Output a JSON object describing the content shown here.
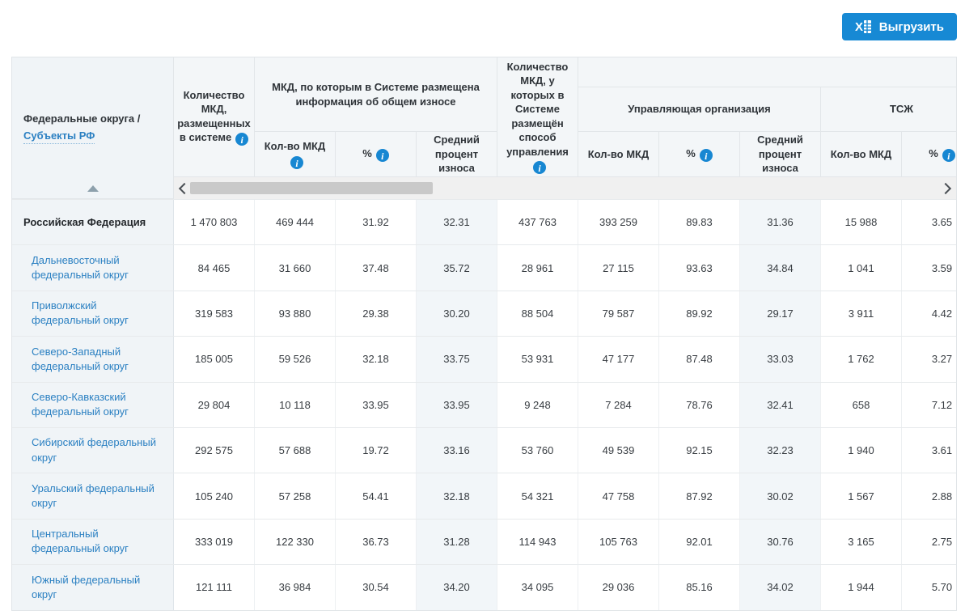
{
  "export_button": {
    "label": "Выгрузить"
  },
  "colors": {
    "accent_blue": "#1789d4",
    "link_blue": "#2b80c2",
    "info_icon_blue": "#1787d2",
    "header_bg": "#f3f6f8",
    "first_col_bg": "#f0f4f7",
    "shaded_col_bg": "#f2f6f9"
  },
  "table": {
    "header": {
      "col1": {
        "title": "Федеральные округа /",
        "link": "Субъекты РФ"
      },
      "col_total": {
        "label": "Количество МКД, размещенных в системе"
      },
      "group_wear": {
        "label": "МКД, по которым в Системе размещена информация об общем износе",
        "subs": [
          {
            "label": "Кол-во МКД"
          },
          {
            "label": "%"
          },
          {
            "label": "Средний процент износа"
          }
        ]
      },
      "col_mgmt": {
        "label": "Количество МКД, у которых в Системе размещён способ управления"
      },
      "group_uo": {
        "label": "Управляющая организация",
        "subs": [
          {
            "label": "Кол-во МКД"
          },
          {
            "label": "%"
          },
          {
            "label": "Средний процент износа"
          }
        ]
      },
      "group_tsj": {
        "label": "ТСЖ",
        "subs": [
          {
            "label": "Кол-во МКД"
          },
          {
            "label": "%"
          }
        ]
      }
    },
    "rows": [
      {
        "name": "Российская Федерация",
        "link": false,
        "values": [
          "1 470 803",
          "469 444",
          "31.92",
          "32.31",
          "437 763",
          "393 259",
          "89.83",
          "31.36",
          "15 988",
          "3.65"
        ]
      },
      {
        "name": "Дальневосточный федеральный округ",
        "link": true,
        "values": [
          "84 465",
          "31 660",
          "37.48",
          "35.72",
          "28 961",
          "27 115",
          "93.63",
          "34.84",
          "1 041",
          "3.59"
        ]
      },
      {
        "name": "Приволжский федеральный округ",
        "link": true,
        "values": [
          "319 583",
          "93 880",
          "29.38",
          "30.20",
          "88 504",
          "79 587",
          "89.92",
          "29.17",
          "3 911",
          "4.42"
        ]
      },
      {
        "name": "Северо-Западный федеральный округ",
        "link": true,
        "values": [
          "185 005",
          "59 526",
          "32.18",
          "33.75",
          "53 931",
          "47 177",
          "87.48",
          "33.03",
          "1 762",
          "3.27"
        ]
      },
      {
        "name": "Северо-Кавказский федеральный округ",
        "link": true,
        "values": [
          "29 804",
          "10 118",
          "33.95",
          "33.95",
          "9 248",
          "7 284",
          "78.76",
          "32.41",
          "658",
          "7.12"
        ]
      },
      {
        "name": "Сибирский федеральный округ",
        "link": true,
        "values": [
          "292 575",
          "57 688",
          "19.72",
          "33.16",
          "53 760",
          "49 539",
          "92.15",
          "32.23",
          "1 940",
          "3.61"
        ]
      },
      {
        "name": "Уральский федеральный округ",
        "link": true,
        "values": [
          "105 240",
          "57 258",
          "54.41",
          "32.18",
          "54 321",
          "47 758",
          "87.92",
          "30.02",
          "1 567",
          "2.88"
        ]
      },
      {
        "name": "Центральный федеральный округ",
        "link": true,
        "values": [
          "333 019",
          "122 330",
          "36.73",
          "31.28",
          "114 943",
          "105 763",
          "92.01",
          "30.76",
          "3 165",
          "2.75"
        ]
      },
      {
        "name": "Южный федеральный округ",
        "link": true,
        "values": [
          "121 111",
          "36 984",
          "30.54",
          "34.20",
          "34 095",
          "29 036",
          "85.16",
          "34.02",
          "1 944",
          "5.70"
        ]
      }
    ]
  }
}
